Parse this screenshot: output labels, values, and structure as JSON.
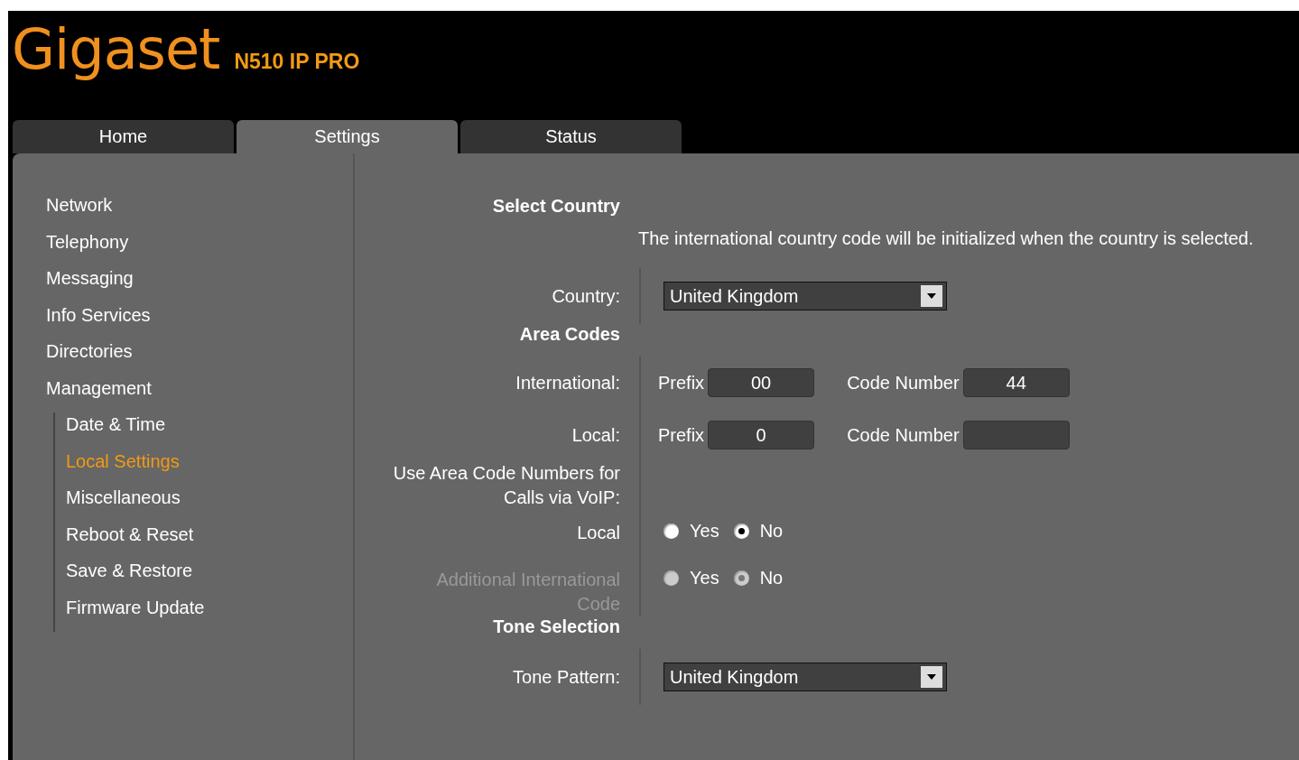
{
  "brand": {
    "logo": "Gigaset",
    "model": "N510 IP PRO"
  },
  "tabs": [
    {
      "label": "Home",
      "selected": false
    },
    {
      "label": "Settings",
      "selected": true
    },
    {
      "label": "Status",
      "selected": false
    }
  ],
  "sidebar": {
    "items": [
      {
        "label": "Network",
        "selected": false
      },
      {
        "label": "Telephony",
        "selected": false
      },
      {
        "label": "Messaging",
        "selected": false
      },
      {
        "label": "Info Services",
        "selected": false
      },
      {
        "label": "Directories",
        "selected": false
      },
      {
        "label": "Management",
        "selected": false,
        "children": [
          {
            "label": "Date & Time",
            "selected": false
          },
          {
            "label": "Local Settings",
            "selected": true
          },
          {
            "label": "Miscellaneous",
            "selected": false
          },
          {
            "label": "Reboot & Reset",
            "selected": false
          },
          {
            "label": "Save & Restore",
            "selected": false
          },
          {
            "label": "Firmware Update",
            "selected": false
          }
        ]
      }
    ]
  },
  "content": {
    "rows": [
      {
        "kind": "heading",
        "label": "Select Country"
      },
      {
        "kind": "note",
        "text": "The international country code will be initialized when the country is selected."
      },
      {
        "kind": "select",
        "label": "Country:",
        "value": "United Kingdom"
      },
      {
        "kind": "heading",
        "label": "Area Codes"
      },
      {
        "kind": "codes",
        "label": "International:",
        "prefix_label": "Prefix",
        "prefix": "00",
        "code_label": "Code Number",
        "code": "44"
      },
      {
        "kind": "codes",
        "label": "Local:",
        "prefix_label": "Prefix",
        "prefix": "0",
        "code_label": "Code Number"
      },
      {
        "kind": "label",
        "label": "Use Area Code Numbers for Calls via VoIP:"
      },
      {
        "kind": "radio",
        "label": "Local",
        "disabled": false,
        "options": [
          {
            "label": "Yes",
            "selected": false
          },
          {
            "label": "No",
            "selected": true
          }
        ]
      },
      {
        "kind": "radio",
        "label": "Additional International Code",
        "disabled": true,
        "options": [
          {
            "label": "Yes",
            "selected": false
          },
          {
            "label": "No",
            "selected": true
          }
        ]
      },
      {
        "kind": "heading",
        "label": "Tone Selection"
      },
      {
        "kind": "select",
        "label": "Tone Pattern:",
        "value": "United Kingdom"
      }
    ]
  }
}
